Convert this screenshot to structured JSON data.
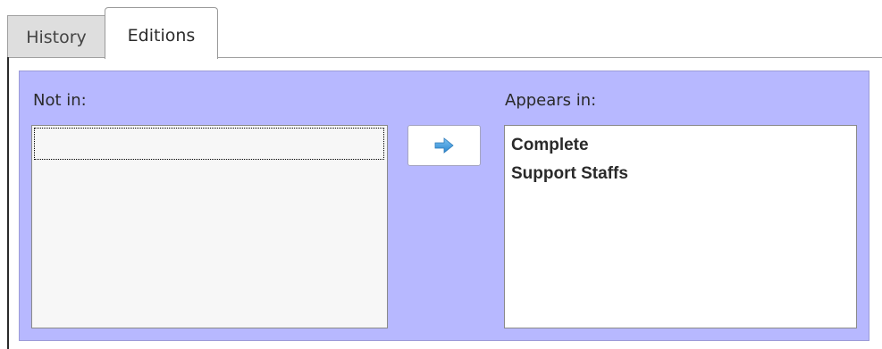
{
  "tabs": {
    "history_label": "History",
    "editions_label": "Editions",
    "active": "Editions"
  },
  "editions": {
    "not_in_label": "Not in:",
    "appears_in_label": "Appears in:",
    "not_in_items": [],
    "appears_in_items": [
      "Complete",
      "Support Staffs"
    ],
    "move_button_icon": "arrow-right-icon"
  },
  "colors": {
    "panel_background": "#b7b8ff",
    "arrow": "#3a9ad9"
  }
}
